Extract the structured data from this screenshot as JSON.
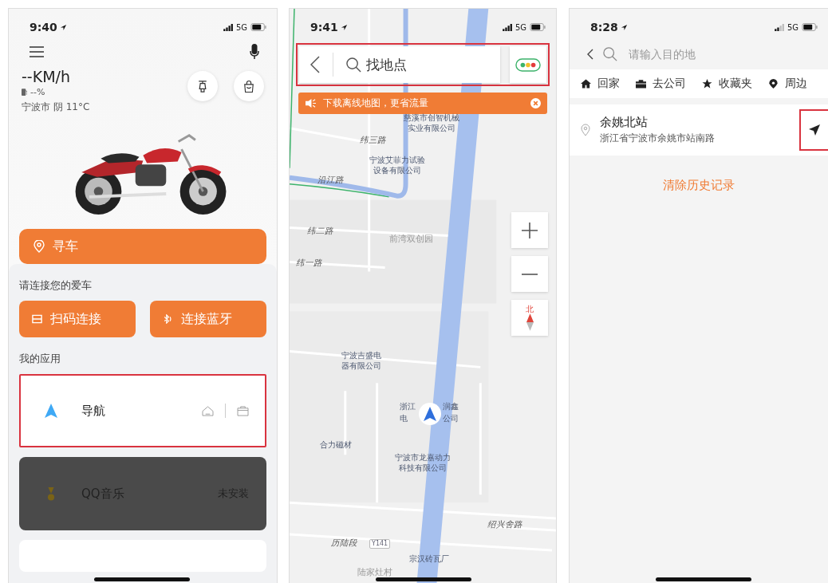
{
  "home_screen": {
    "status": {
      "time": "9:40",
      "network": "5G"
    },
    "speed": "--KM/h",
    "fuel": "--%",
    "weather": "宁波市 阴 11°C",
    "find_car": "寻车",
    "connect_prompt": "请连接您的爱车",
    "connect_buttons": [
      {
        "kind": "scan",
        "label": "扫码连接"
      },
      {
        "kind": "bluetooth",
        "label": "连接蓝牙"
      }
    ],
    "apps_title": "我的应用",
    "apps": [
      {
        "kind": "navigation",
        "name": "导航",
        "installed": true,
        "highlighted": true
      },
      {
        "kind": "music",
        "name": "QQ音乐",
        "installed": false,
        "status": "未安装",
        "highlighted": false
      }
    ]
  },
  "map_screen": {
    "status": {
      "time": "9:41",
      "network": "5G"
    },
    "search": {
      "placeholder": "找地点",
      "highlighted": true
    },
    "banner": "下载离线地图，更省流量",
    "compass": "北",
    "map_labels": [
      {
        "kind": "poi",
        "lines": [
          "慈溪市创智机械",
          "实业有限公司"
        ]
      },
      {
        "kind": "road",
        "lines": [
          "纬三路"
        ]
      },
      {
        "kind": "poi",
        "lines": [
          "宁波艾菲力试验",
          "设备有限公司"
        ]
      },
      {
        "kind": "road",
        "lines": [
          "沿江路"
        ]
      },
      {
        "kind": "road",
        "lines": [
          "纬二路"
        ]
      },
      {
        "kind": "area",
        "lines": [
          "前湾双创园"
        ]
      },
      {
        "kind": "road",
        "lines": [
          "纬一路"
        ]
      },
      {
        "kind": "poi",
        "lines": [
          "宁波吉盛电",
          "器有限公司"
        ]
      },
      {
        "kind": "poi",
        "lines": [
          "浙江"
        ]
      },
      {
        "kind": "plain",
        "lines": [
          "润鑫"
        ]
      },
      {
        "kind": "plain",
        "lines": [
          "电"
        ]
      },
      {
        "kind": "plain",
        "lines": [
          "公司"
        ]
      },
      {
        "kind": "poi",
        "lines": [
          "合力磁材"
        ]
      },
      {
        "kind": "poi",
        "lines": [
          "宁波市龙嘉动力",
          "科技有限公司"
        ]
      },
      {
        "kind": "road",
        "lines": [
          "绍兴舍路"
        ]
      },
      {
        "kind": "road",
        "lines": [
          "历陆段"
        ]
      },
      {
        "kind": "badge",
        "lines": [
          "Y141"
        ]
      },
      {
        "kind": "poi",
        "lines": [
          "宗汉砖瓦厂"
        ]
      },
      {
        "kind": "area",
        "lines": [
          "陆家灶村"
        ]
      }
    ]
  },
  "search_screen": {
    "status": {
      "time": "8:28",
      "network": "5G"
    },
    "search": {
      "placeholder": "请输入目的地"
    },
    "shortcuts": [
      {
        "kind": "home",
        "label": "回家"
      },
      {
        "kind": "work",
        "label": "去公司"
      },
      {
        "kind": "favorites",
        "label": "收藏夹"
      },
      {
        "kind": "nearby",
        "label": "周边"
      }
    ],
    "history": [
      {
        "name": "余姚北站",
        "address": "浙江省宁波市余姚市站南路",
        "highlighted": true
      }
    ],
    "clear_history": "清除历史记录"
  }
}
